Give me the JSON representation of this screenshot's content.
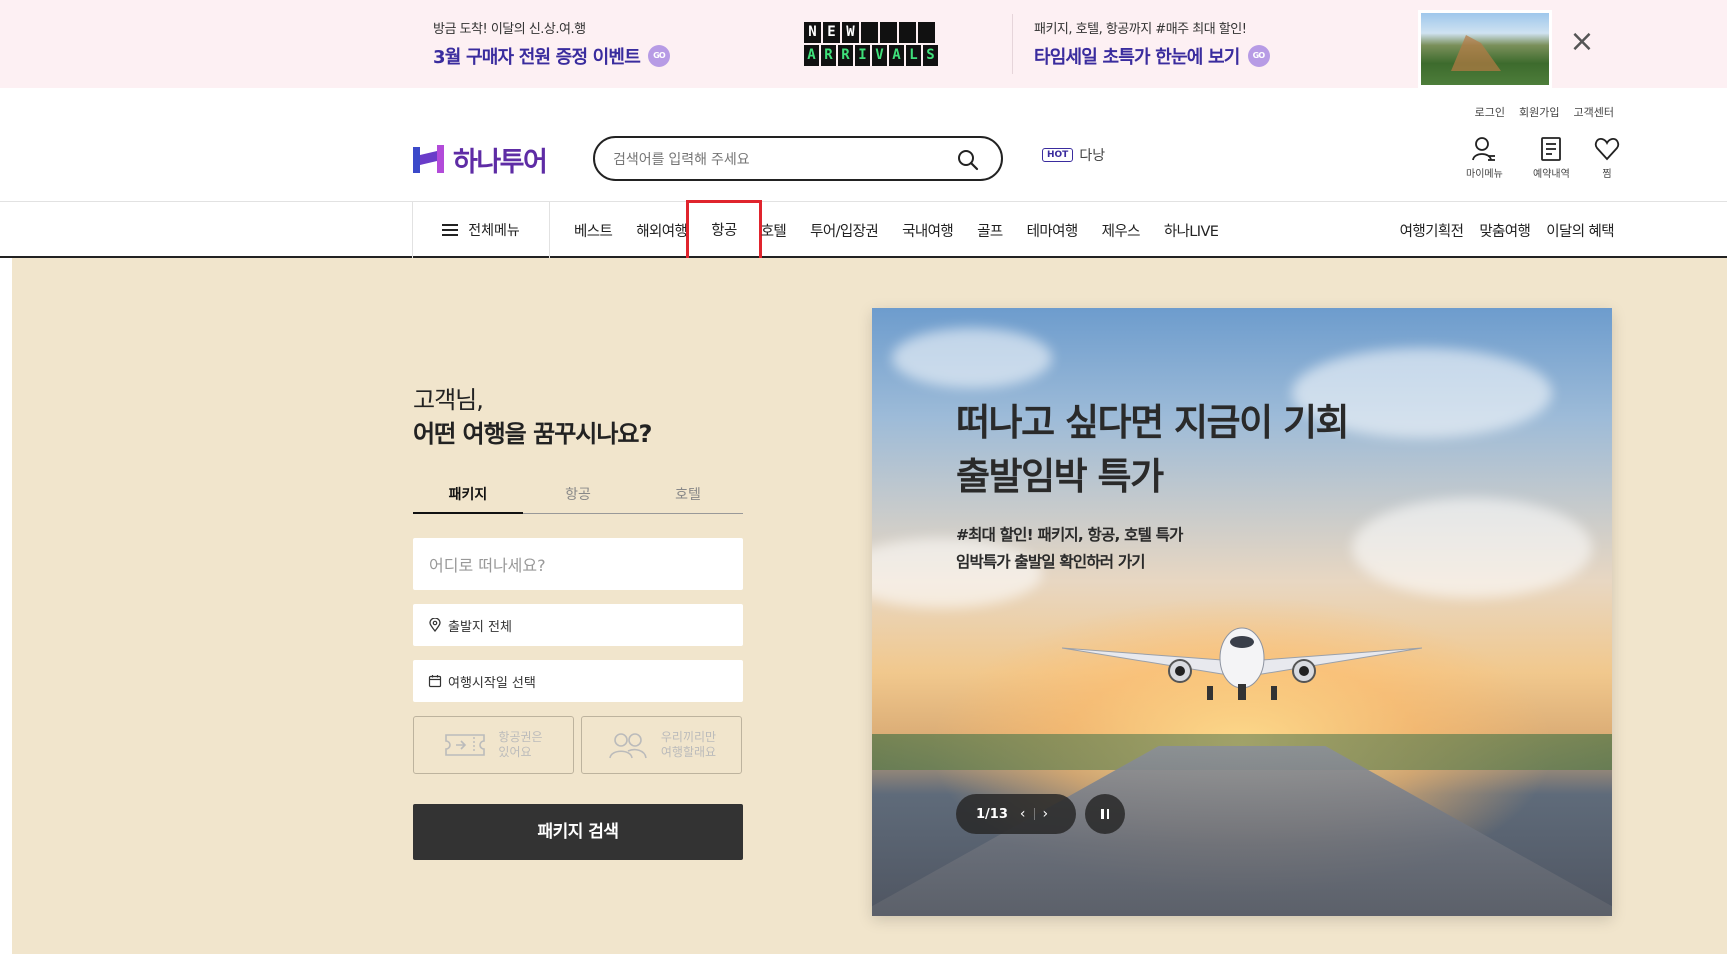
{
  "promo": {
    "left_small": "방금 도착! 이달의 신.상.여.행",
    "left_big": "3월 구매자 전원 증정 이벤트",
    "go_label": "GO",
    "flap_row1": [
      "N",
      "E",
      "W",
      "",
      "",
      "",
      ""
    ],
    "flap_row2": [
      "A",
      "R",
      "R",
      "I",
      "V",
      "A",
      "L",
      "S"
    ],
    "right_small": "패키지, 호텔, 항공까지 #매주 최대 할인!",
    "right_big": "타임세일 초특가 한눈에 보기",
    "close_symbol": "×"
  },
  "header": {
    "util_links": [
      "로그인",
      "회원가입",
      "고객센터"
    ],
    "logo_text": "하나투어",
    "brand_color": "#5e2ca5",
    "search_placeholder": "검색어를 입력해 주세요",
    "hot_badge": "HOT",
    "hot_keyword": "다낭",
    "quick_links": [
      {
        "label": "마이메뉴",
        "icon": "user-icon"
      },
      {
        "label": "예약내역",
        "icon": "document-icon"
      },
      {
        "label": "찜",
        "icon": "heart-icon"
      }
    ]
  },
  "nav": {
    "all_menu_label": "전체메뉴",
    "items": [
      "베스트",
      "해외여행",
      "항공",
      "호텔",
      "투어/입장권",
      "국내여행",
      "골프",
      "테마여행",
      "제우스",
      "하나LIVE"
    ],
    "highlighted_item": "항공",
    "right_items": [
      "여행기획전",
      "맞춤여행",
      "이달의 혜택"
    ]
  },
  "search_panel": {
    "greeting_line1": "고객님,",
    "greeting_line2": "어떤 여행을 꿈꾸시나요?",
    "tabs": [
      "패키지",
      "항공",
      "호텔"
    ],
    "active_tab": "패키지",
    "destination_placeholder": "어디로 떠나세요?",
    "departure_label": "출발지 전체",
    "date_label": "여행시작일 선택",
    "option_ticket_line1": "항공권은",
    "option_ticket_line2": "있어요",
    "option_group_line1": "우리끼리만",
    "option_group_line2": "여행할래요",
    "search_button": "패키지 검색"
  },
  "hero": {
    "title_line1": "떠나고 싶다면 지금이 기회",
    "title_line2": "출발임박 특가",
    "sub_line1": "#최대 할인! 패키지, 항공, 호텔 특가",
    "sub_line2": "임박특가 출발일 확인하러 가기",
    "pager_text": "1/13",
    "prev_symbol": "‹",
    "next_symbol": "›"
  }
}
